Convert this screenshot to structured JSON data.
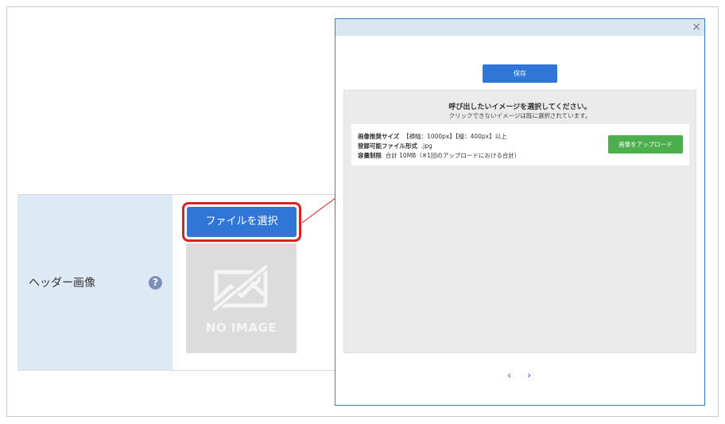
{
  "form": {
    "label": "ヘッダー画像",
    "help_icon": "?",
    "select_button": "ファイルを選択",
    "no_image": "NO IMAGE"
  },
  "modal": {
    "close": "×",
    "save_button": "保存",
    "prompt_title": "呼び出したいイメージを選択してください。",
    "prompt_sub": "クリックできないイメージは既に選択されています。",
    "info": [
      {
        "label": "画像推奨サイズ",
        "value": "【横幅：1000px】【縦：400px】以上"
      },
      {
        "label": "登録可能ファイル形式",
        "value": ".jpg"
      },
      {
        "label": "容量制限",
        "value": "合計 10MB（※1回のアップロードにおける合計）"
      }
    ],
    "upload_button": "画像をアップロード",
    "pager_prev": "‹",
    "pager_next": "›"
  },
  "colors": {
    "primary": "#2f76d6",
    "upload": "#4cae4c",
    "highlight": "#e02020",
    "label_bg": "#dde9f5"
  }
}
